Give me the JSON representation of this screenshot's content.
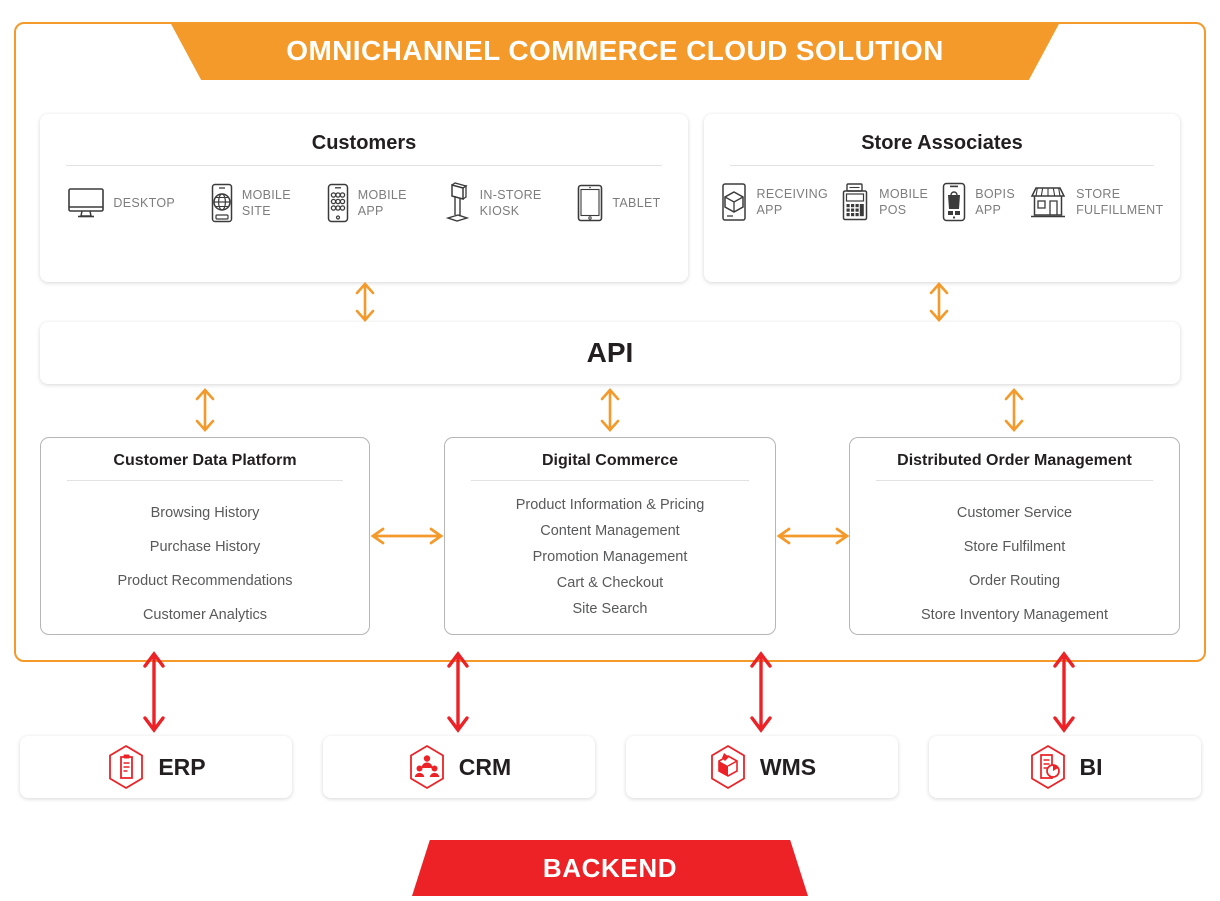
{
  "header": {
    "title": "OMNICHANNEL COMMERCE CLOUD SOLUTION",
    "color": "#F39A2B"
  },
  "frame": {
    "border_color": "#F39A2B"
  },
  "channels": [
    {
      "title": "Customers",
      "items": [
        {
          "icon": "desktop-monitor-icon",
          "label": "DESKTOP"
        },
        {
          "icon": "mobile-globe-icon",
          "label": "MOBILE\nSITE"
        },
        {
          "icon": "mobile-app-grid-icon",
          "label": "MOBILE\nAPP"
        },
        {
          "icon": "kiosk-stand-icon",
          "label": "IN-STORE\nKIOSK"
        },
        {
          "icon": "tablet-icon",
          "label": "TABLET"
        }
      ]
    },
    {
      "title": "Store Associates",
      "items": [
        {
          "icon": "receiving-box-phone-icon",
          "label": "RECEIVING\nAPP"
        },
        {
          "icon": "pos-terminal-icon",
          "label": "MOBILE\nPOS"
        },
        {
          "icon": "bopis-bag-phone-icon",
          "label": "BOPIS\nAPP"
        },
        {
          "icon": "storefront-icon",
          "label": "STORE\nFULFILLMENT"
        }
      ]
    }
  ],
  "api": {
    "title": "API"
  },
  "capabilities": [
    {
      "title": "Customer Data Platform",
      "spacing": "wide",
      "items": [
        "Browsing History",
        "Purchase History",
        "Product Recommendations",
        "Customer Analytics"
      ]
    },
    {
      "title": "Digital Commerce",
      "spacing": "tight",
      "items": [
        "Product Information & Pricing",
        "Content Management",
        "Promotion Management",
        "Cart & Checkout",
        "Site Search"
      ]
    },
    {
      "title": "Distributed Order Management",
      "spacing": "wide",
      "items": [
        "Customer Service",
        "Store Fulfilment",
        "Order Routing",
        "Store Inventory Management"
      ]
    }
  ],
  "backend_systems": [
    {
      "icon": "hexagon-clipboard-icon",
      "label": "ERP"
    },
    {
      "icon": "hexagon-people-icon",
      "label": "CRM"
    },
    {
      "icon": "hexagon-warehouse-box-icon",
      "label": "WMS"
    },
    {
      "icon": "hexagon-report-chart-icon",
      "label": "BI"
    }
  ],
  "backend_banner": {
    "title": "BACKEND",
    "color": "#EC2227"
  },
  "arrows": {
    "vertical_orange_color": "#F39A2B",
    "horizontal_orange_color": "#F39A2B",
    "vertical_red_color": "#EC2227"
  }
}
